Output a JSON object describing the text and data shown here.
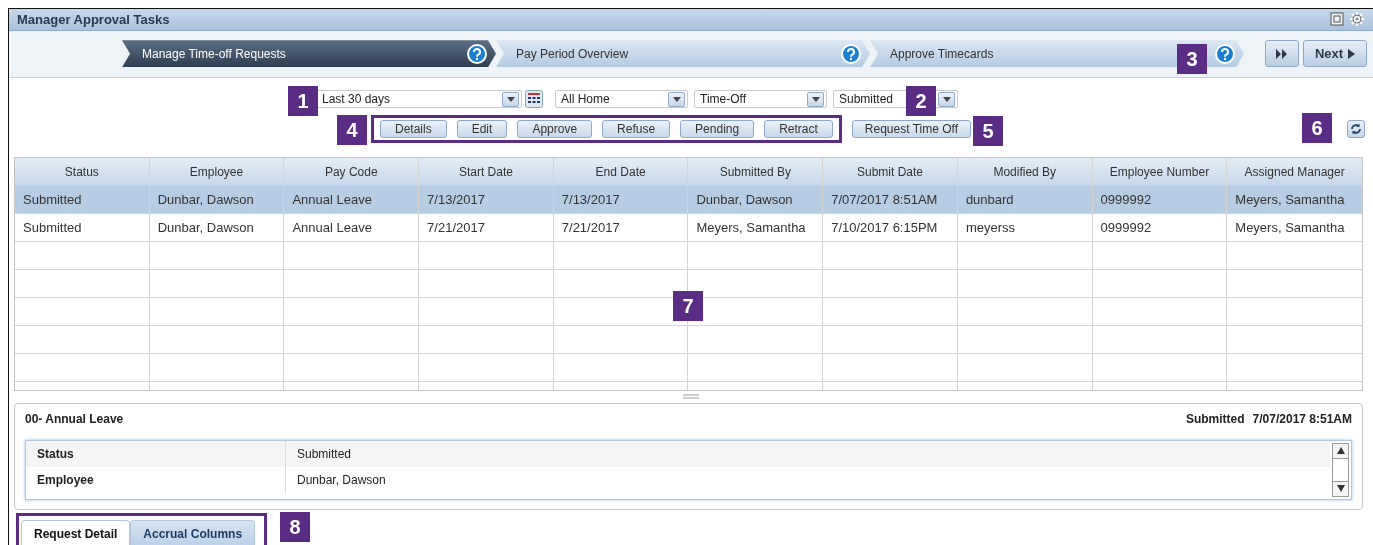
{
  "window": {
    "title": "Manager Approval Tasks"
  },
  "wizard": {
    "steps": [
      {
        "label": "Manage Time-off Requests",
        "selected": true
      },
      {
        "label": "Pay Period Overview",
        "selected": false
      },
      {
        "label": "Approve Timecards",
        "selected": false
      }
    ],
    "next_label": "Next"
  },
  "filters": [
    {
      "value": "Last 30 days",
      "calendar": true
    },
    {
      "value": "All Home",
      "calendar": false
    },
    {
      "value": "Time-Off",
      "calendar": false
    },
    {
      "value": "Submitted",
      "calendar": false
    }
  ],
  "actions": [
    "Details",
    "Edit",
    "Approve",
    "Refuse",
    "Pending",
    "Retract"
  ],
  "request_button": "Request Time Off",
  "table": {
    "columns": [
      "Status",
      "Employee",
      "Pay Code",
      "Start Date",
      "End Date",
      "Submitted By",
      "Submit Date",
      "Modified By",
      "Employee Number",
      "Assigned Manager"
    ],
    "rows": [
      {
        "selected": true,
        "cells": [
          "Submitted",
          "Dunbar, Dawson",
          "Annual Leave",
          "7/13/2017",
          "7/13/2017",
          "Dunbar, Dawson",
          "7/07/2017 8:51AM",
          "dunbard",
          "0999992",
          "Meyers, Samantha"
        ]
      },
      {
        "selected": false,
        "cells": [
          "Submitted",
          "Dunbar, Dawson",
          "Annual Leave",
          "7/21/2017",
          "7/21/2017",
          "Meyers, Samantha",
          "7/10/2017 6:15PM",
          "meyerss",
          "0999992",
          "Meyers, Samantha"
        ]
      }
    ]
  },
  "detail": {
    "title": "00- Annual Leave",
    "status": "Submitted",
    "date": "7/07/2017 8:51AM",
    "fields": [
      {
        "label": "Status",
        "value": "Submitted"
      },
      {
        "label": "Employee",
        "value": "Dunbar, Dawson"
      }
    ]
  },
  "tabs": [
    {
      "label": "Request Detail",
      "selected": true
    },
    {
      "label": "Accrual Columns",
      "selected": false
    }
  ],
  "callouts": [
    "1",
    "2",
    "3",
    "4",
    "5",
    "6",
    "7",
    "8"
  ]
}
